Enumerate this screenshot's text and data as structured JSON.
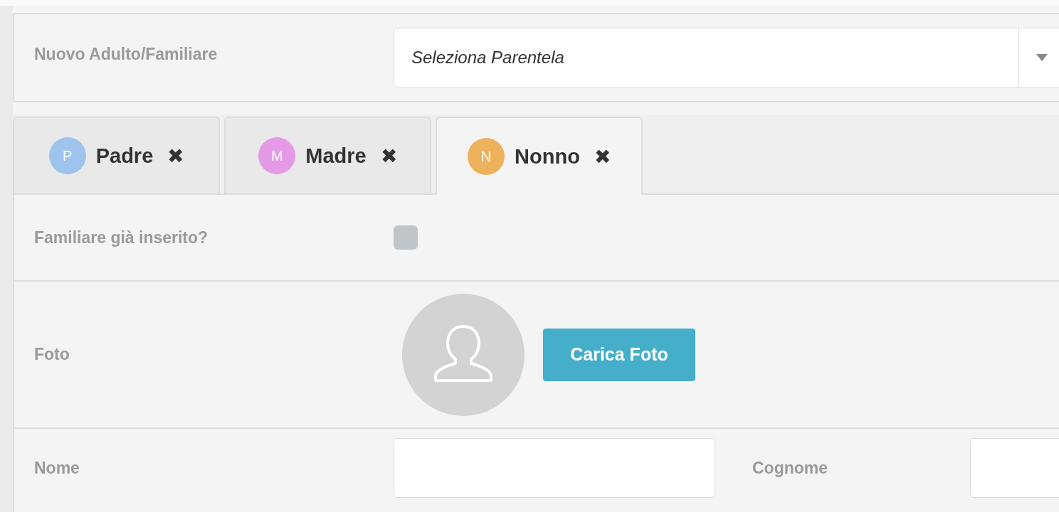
{
  "new_member": {
    "label": "Nuovo Adulto/Familiare",
    "select": {
      "placeholder": "Seleziona Parentela"
    }
  },
  "tabs": [
    {
      "initial": "P",
      "label": "Padre",
      "color": "#9ec3ed",
      "close": "✖",
      "selected": false
    },
    {
      "initial": "M",
      "label": "Madre",
      "color": "#e59ae8",
      "close": "✖",
      "selected": false
    },
    {
      "initial": "N",
      "label": "Nonno",
      "color": "#eeb15c",
      "close": "✖",
      "selected": true
    }
  ],
  "form": {
    "existing": {
      "label": "Familiare già inserito?",
      "checked": false
    },
    "photo": {
      "label": "Foto",
      "button": "Carica Foto"
    },
    "fields": [
      {
        "label": "Nome"
      },
      {
        "label": "Cognome"
      }
    ]
  }
}
